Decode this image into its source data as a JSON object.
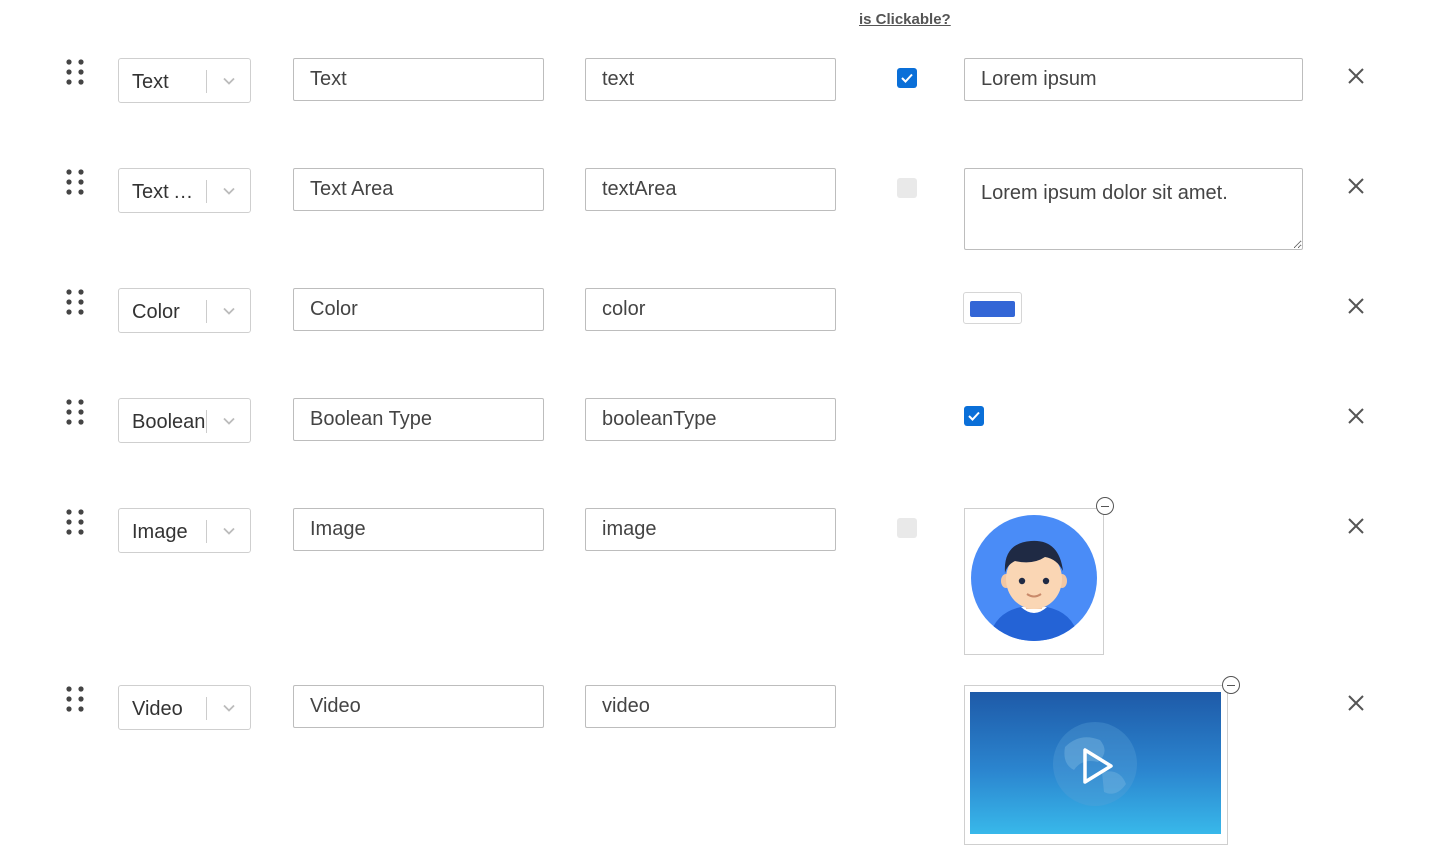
{
  "header": {
    "clickable_label": "is Clickable?"
  },
  "rows": [
    {
      "type": "Text",
      "label": "Text",
      "key": "text",
      "clickable": true,
      "value": "Lorem ipsum"
    },
    {
      "type": "Text Area",
      "label": "Text Area",
      "key": "textArea",
      "clickable": false,
      "value": "Lorem ipsum dolor sit amet."
    },
    {
      "type": "Color",
      "label": "Color",
      "key": "color",
      "value": "#3366d6"
    },
    {
      "type": "Boolean",
      "label": "Boolean Type",
      "key": "booleanType",
      "value": true
    },
    {
      "type": "Image",
      "label": "Image",
      "key": "image",
      "clickable": false,
      "value_icon": "avatar-image"
    },
    {
      "type": "Video",
      "label": "Video",
      "key": "video",
      "value_icon": "video-thumbnail"
    }
  ],
  "icons": {
    "drag": "drag-handle-icon",
    "dropdown": "chevron-down-icon",
    "remove": "close-icon",
    "check": "check-icon",
    "media_remove": "minus-circle-icon",
    "play": "play-icon"
  },
  "colors": {
    "accent": "#0a6fd8",
    "avatar_bg": "#4a8cf7",
    "video_gradient": [
      "#1e5aa8",
      "#38b8ea"
    ]
  }
}
